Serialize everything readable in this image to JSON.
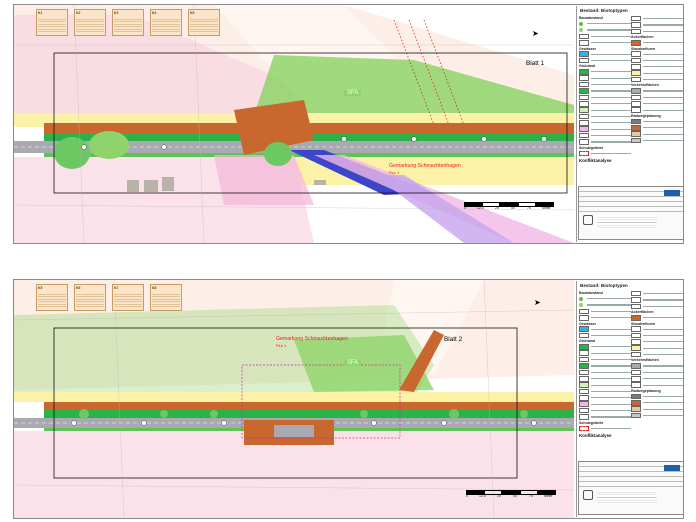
{
  "sheets": [
    {
      "id": "sheet1",
      "blatt": "Blatt 1",
      "sfa": "SFA",
      "gemarkung": "Gemarkung Schmachtenhagen",
      "flur": "Flur 1",
      "notes": [
        "K1",
        "K2",
        "K3",
        "K4",
        "K5"
      ],
      "scale_labels": [
        "0",
        "12,5",
        "25",
        "50",
        "75",
        "Meter"
      ]
    },
    {
      "id": "sheet2",
      "blatt": "Blatt 2",
      "sfa": "SFA",
      "gemarkung": "Gemarkung Schmachtenhagen",
      "flur": "Flur 1",
      "notes": [
        "K5",
        "K6",
        "K7",
        "K8"
      ],
      "scale_labels": [
        "0",
        "12,5",
        "25",
        "50",
        "75",
        "Meter"
      ]
    }
  ],
  "legend": {
    "title": "Bestand: Biotoptypen",
    "sections": {
      "baumbestand": "Baumbestand",
      "gewaesser": "Gewässer",
      "gruenland": "Grünland",
      "ackerflaechen": "Ackerflächen",
      "staudenfluren": "Staudenfluren",
      "verkehrsflaechen": "Verkehrsflächen",
      "schutzgebiete": "Schutzgebiete",
      "konfliktanalyse": "Konfliktanalyse",
      "radwegeplanung": "Radwegeplanung"
    }
  },
  "colors": {
    "field_green": "#8fd46a",
    "dark_green": "#2db24a",
    "road_orange": "#c8682e",
    "road_grey": "#a9a9b1",
    "pink": "#f6c9d7",
    "yellow_strip": "#fbf2a8",
    "boundary_red": "#e2221e"
  }
}
